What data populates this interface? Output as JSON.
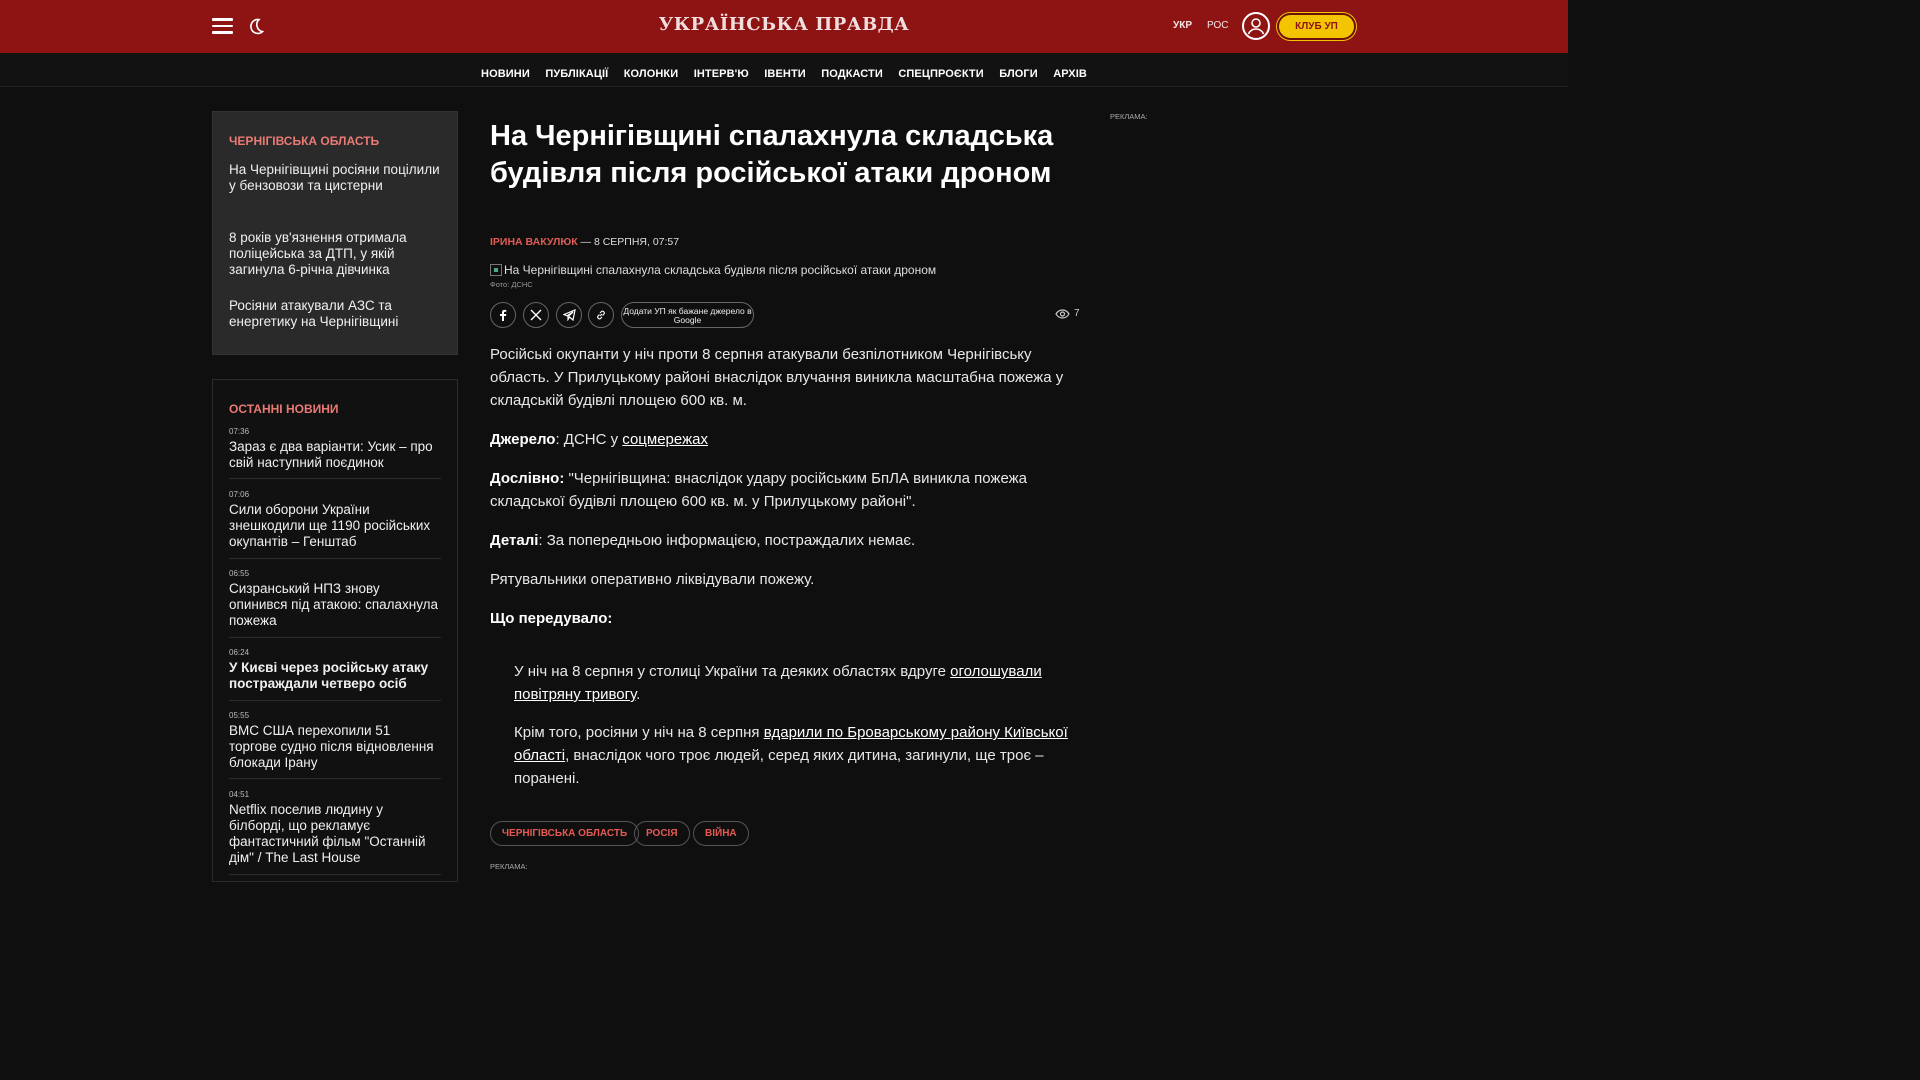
{
  "header": {
    "logo": "УКРАЇНСЬКА ПРАВДА",
    "lang_ukr": "УКР",
    "lang_ros": "РОС",
    "club": "КЛУБ УП"
  },
  "nav": [
    "НОВИНИ",
    "ПУБЛІКАЦІЇ",
    "КОЛОНКИ",
    "ІНТЕРВ'Ю",
    "ІВЕНТИ",
    "ПОДКАСТИ",
    "СПЕЦПРОЄКТИ",
    "БЛОГИ",
    "АРХІВ"
  ],
  "sidebar": {
    "region_head": "ЧЕРНІГІВСЬКА ОБЛАСТЬ",
    "region_items": [
      "На Чернігівщині росіяни поцілили у бензовози та цистерни",
      "8 років ув'язнення отримала поліцейська за ДТП, у якій загинула 6-річна дівчинка",
      "Росіяни атакували АЗС та енергетику на Чернігівщині"
    ],
    "latest_head": "ОСТАННІ НОВИНИ",
    "latest": [
      {
        "time": "07:36",
        "title": "Зараз є два варіанти: Усик – про свій наступний поєдинок"
      },
      {
        "time": "07:06",
        "title": "Сили оборони України знешкодили ще 1190 російських окупантів – Генштаб"
      },
      {
        "time": "06:55",
        "title": "Сизранський НПЗ знову опинився під атакою: спалахнула пожежа"
      },
      {
        "time": "06:24",
        "title": "У Києві через російську атаку постраждали четверо осіб"
      },
      {
        "time": "05:55",
        "title": "ВМС США перехопили 51 торгове судно після відновлення блокади Ірану"
      },
      {
        "time": "04:51",
        "title": "Netflix поселив людину у білборді, що рекламує фантастичний фільм \"Останній дім\" / The Last House"
      }
    ]
  },
  "article": {
    "title": "На Чернігівщині спалахнула складська будівля після російської атаки дроном",
    "author": "ІРИНА ВАКУЛЮК",
    "date": " — 8 СЕРПНЯ, 07:57",
    "image_alt": "На Чернігівщині спалахнула складська будівля після російської атаки дроном",
    "credit": "Фото: ДСНС",
    "google_btn": "Додати УП як бажане джерело в Google",
    "views": "7",
    "lead": "Російські окупанти у ніч проти 8 серпня атакували безпілотником Чернігівську область. У Прилуцькому районі внаслідок влучання виникла масштабна пожежа у складській будівлі площею 600 кв. м.",
    "source_label": "Джерело",
    "source_text": ": ДСНС у ",
    "source_link": "соцмережах",
    "verbatim_label": "Дослівно:",
    "verbatim_text": " \"Чернігівщина: внаслідок удару російським БпЛА виникла пожежа складської будівлі площею 600 кв. м. у Прилуцькому районі\".",
    "details_label": "Деталі",
    "details_text": ": За попередньою інформацією, постраждалих немає.",
    "rescue": "Рятувальники оперативно ліквідували пожежу.",
    "before_label": "Що передувало:",
    "q1_pre": "У ніч на 8 серпня у столиці України та деяких областях вдруге ",
    "q1_link": "оголошували повітряну тривогу",
    "q1_post": ".",
    "q2_pre": "Крім того, росіяни у ніч на 8 серпня ",
    "q2_link": "вдарили по Броварському району Київської області",
    "q2_post": ", внаслідок чого троє людей, серед яких дитина, загинули, ще троє – поранені.",
    "tags": [
      "ЧЕРНІГІВСЬКА ОБЛАСТЬ",
      "РОСІЯ",
      "ВІЙНА"
    ],
    "ad_label": "РЕКЛАМА:"
  },
  "right": {
    "ad_label": "РЕКЛАМА:"
  }
}
